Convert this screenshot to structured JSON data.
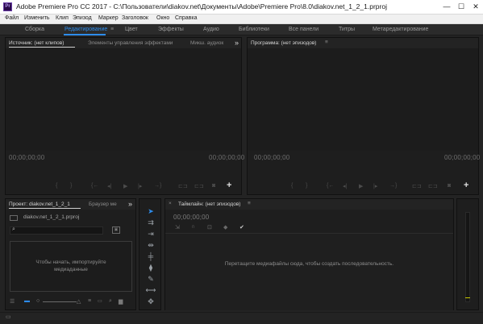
{
  "window": {
    "app_icon_label": "Pr",
    "title": "Adobe Premiere Pro CC 2017 - C:\\Пользователи\\diakov.net\\Документы\\Adobe\\Premiere Pro\\8.0\\diakov.net_1_2_1.prproj",
    "minimize_glyph": "—",
    "maximize_glyph": "☐",
    "close_glyph": "✕"
  },
  "menubar": {
    "items": [
      "Файл",
      "Изменить",
      "Клип",
      "Эпизод",
      "Маркер",
      "Заголовок",
      "Окно",
      "Справка"
    ]
  },
  "workspaces": {
    "items": [
      "Сборка",
      "Редактирование",
      "Цвет",
      "Эффекты",
      "Аудио",
      "Библиотеки",
      "Все панели",
      "Титры",
      "Метаредактирование"
    ],
    "active": "Редактирование",
    "accent_color": "#2d8ceb"
  },
  "source_panel": {
    "tabs": [
      "Источник: (нет клипов)",
      "Элементы управления эффектами",
      "Микш. аудиок"
    ],
    "active_tab": "Источник: (нет клипов)",
    "overflow_glyph": "»",
    "timecode_left": "00;00;00;00",
    "timecode_right": "00;00;00;00",
    "add_glyph": "+"
  },
  "program_panel": {
    "tab": "Программа: (нет эпизодов)",
    "menu_glyph": "≡",
    "timecode_left": "00;00;00;00",
    "timecode_right": "00;00;00;00",
    "add_glyph": "+"
  },
  "project_panel": {
    "tabs": [
      "Проект: diakov.net_1_2_1",
      "Браузер ме"
    ],
    "active_tab": "Проект: diakov.net_1_2_1",
    "overflow_glyph": "»",
    "project_file": "diakov.net_1_2_1.prproj",
    "search_placeholder": "",
    "empty_message_line1": "Чтобы начать, импортируйте",
    "empty_message_line2": "медиаданные"
  },
  "timeline_panel": {
    "close_glyph": "×",
    "tab": "Таймлайн: (нет эпизодов)",
    "menu_glyph": "≡",
    "timecode": "00;00;00;00",
    "empty_message": "Перетащите медиафайлы сюда, чтобы создать последовательность."
  },
  "tools": {
    "icons": [
      "selection-tool-icon",
      "track-select-tool-icon",
      "ripple-edit-tool-icon",
      "rolling-edit-tool-icon",
      "rate-stretch-tool-icon",
      "razor-tool-icon",
      "slip-tool-icon",
      "slide-tool-icon",
      "pen-tool-icon",
      "hand-tool-icon",
      "zoom-tool-icon"
    ]
  }
}
